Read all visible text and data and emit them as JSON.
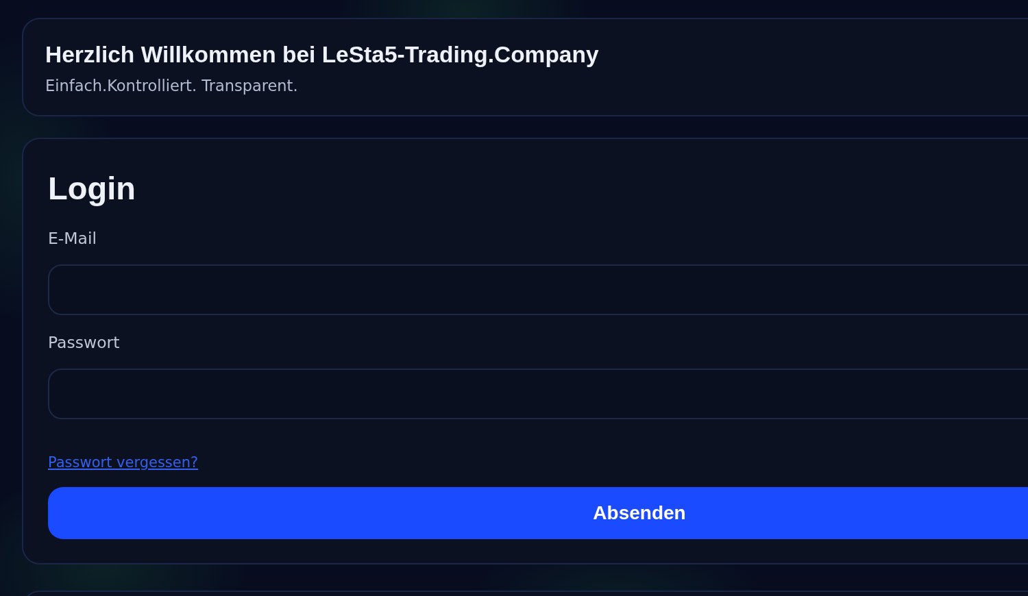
{
  "header": {
    "title": "Herzlich Willkommen bei LeSta5-Trading.Company",
    "subtitle": "Einfach.Kontrolliert. Transparent."
  },
  "login_form": {
    "title": "Login",
    "fields": [
      {
        "label": "E-Mail"
      },
      {
        "label": "Passwort"
      }
    ],
    "forgot_link": "Passwort vergessen?",
    "submit_button": "Absenden"
  }
}
